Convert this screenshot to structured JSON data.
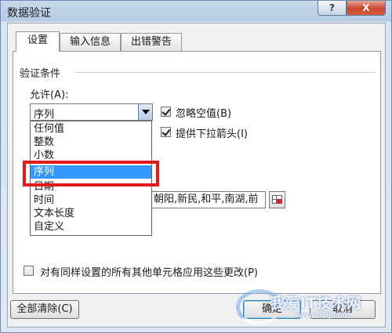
{
  "window": {
    "title": "数据验证",
    "help_label": "?",
    "close_label": "X"
  },
  "tabs": [
    {
      "label": "设置",
      "active": true
    },
    {
      "label": "输入信息",
      "active": false
    },
    {
      "label": "出错警告",
      "active": false
    }
  ],
  "settings": {
    "group_label": "验证条件",
    "allow_label": "允许(A):",
    "allow_selected": "序列",
    "ignore_blank_label": "忽略空值(B)",
    "ignore_blank_checked": true,
    "dropdown_arrow_label": "提供下拉箭头(I)",
    "dropdown_arrow_checked": true,
    "allow_options": [
      "任何值",
      "整数",
      "小数",
      "序列",
      "日期",
      "时间",
      "文本长度",
      "自定义"
    ],
    "allow_highlighted_option": "序列",
    "source_value": "朝阳,新民,和平,南湖,前",
    "apply_all_label": "对有同样设置的所有其他单元格应用这些更改(P)",
    "apply_all_checked": false
  },
  "footer": {
    "clear_all_label": "全部清除(C)",
    "ok_label": "确定",
    "cancel_label": "取消"
  },
  "watermark": {
    "text": "我爱IT技术网",
    "url": "www.52ij.com"
  },
  "colors": {
    "highlight_border": "#e5191c",
    "selection_blue": "#3399ff",
    "close_red": "#c8452c"
  }
}
